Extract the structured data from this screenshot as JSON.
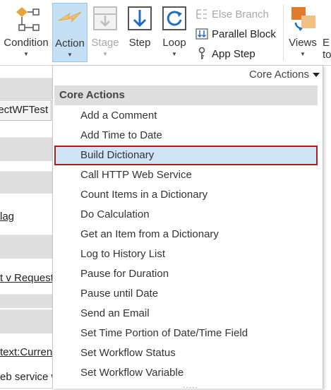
{
  "ribbon": {
    "condition": "Condition",
    "action": "Action",
    "stage": "Stage",
    "step": "Step",
    "loop": "Loop",
    "else_branch": "Else Branch",
    "parallel_block": "Parallel Block",
    "app_step": "App Step",
    "views": "Views",
    "cut_partial": "E",
    "cut_partial_2": "to"
  },
  "background": {
    "field_text": "jectWFTest",
    "link1": "lag",
    "link2": "t v Request",
    "link3": "text:Current",
    "text4": "eb service w"
  },
  "menu": {
    "scope": "Core Actions",
    "header": "Core Actions",
    "selected_index": 2,
    "items": [
      "Add a Comment",
      "Add Time to Date",
      "Build Dictionary",
      "Call HTTP Web Service",
      "Count Items in a Dictionary",
      "Do Calculation",
      "Get an Item from a Dictionary",
      "Log to History List",
      "Pause for Duration",
      "Pause until Date",
      "Send an Email",
      "Set Time Portion of Date/Time Field",
      "Set Workflow Status",
      "Set Workflow Variable"
    ],
    "grip": "....."
  },
  "colors": {
    "selection_fill": "#cfe4f7",
    "selection_border": "#b31b1b",
    "action_button_active": "#c5e0f5",
    "header_band": "#dedede"
  }
}
